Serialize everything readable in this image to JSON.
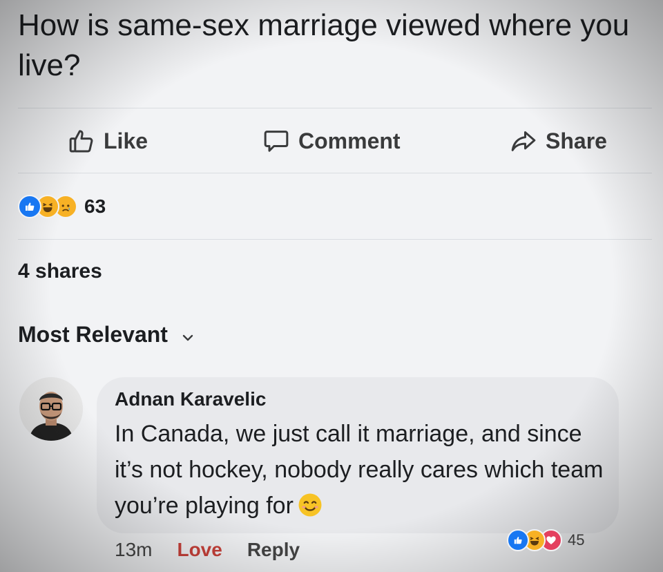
{
  "post": {
    "text": "How is same-sex marriage viewed where you live?"
  },
  "actions": {
    "like": "Like",
    "comment": "Comment",
    "share": "Share"
  },
  "reactions": {
    "icons": [
      "like-icon",
      "haha-icon",
      "sad-icon"
    ],
    "count": "63"
  },
  "shares": "4 shares",
  "sort": {
    "label": "Most Relevant"
  },
  "comment": {
    "author": "Adnan Karavelic",
    "text": "In Canada, we just call it marriage, and since it’s not hockey, nobody really cares which team you’re playing for",
    "emoji": "smiling-face-emoji",
    "time": "13m",
    "love_label": "Love",
    "reply_label": "Reply",
    "reactions": {
      "icons": [
        "like-icon",
        "haha-icon",
        "love-icon"
      ],
      "count": "45"
    }
  },
  "colors": {
    "background": "#f2f3f5",
    "like_blue": "#1877f2",
    "love_red": "#c8413a",
    "bubble": "#e8e9ec"
  }
}
